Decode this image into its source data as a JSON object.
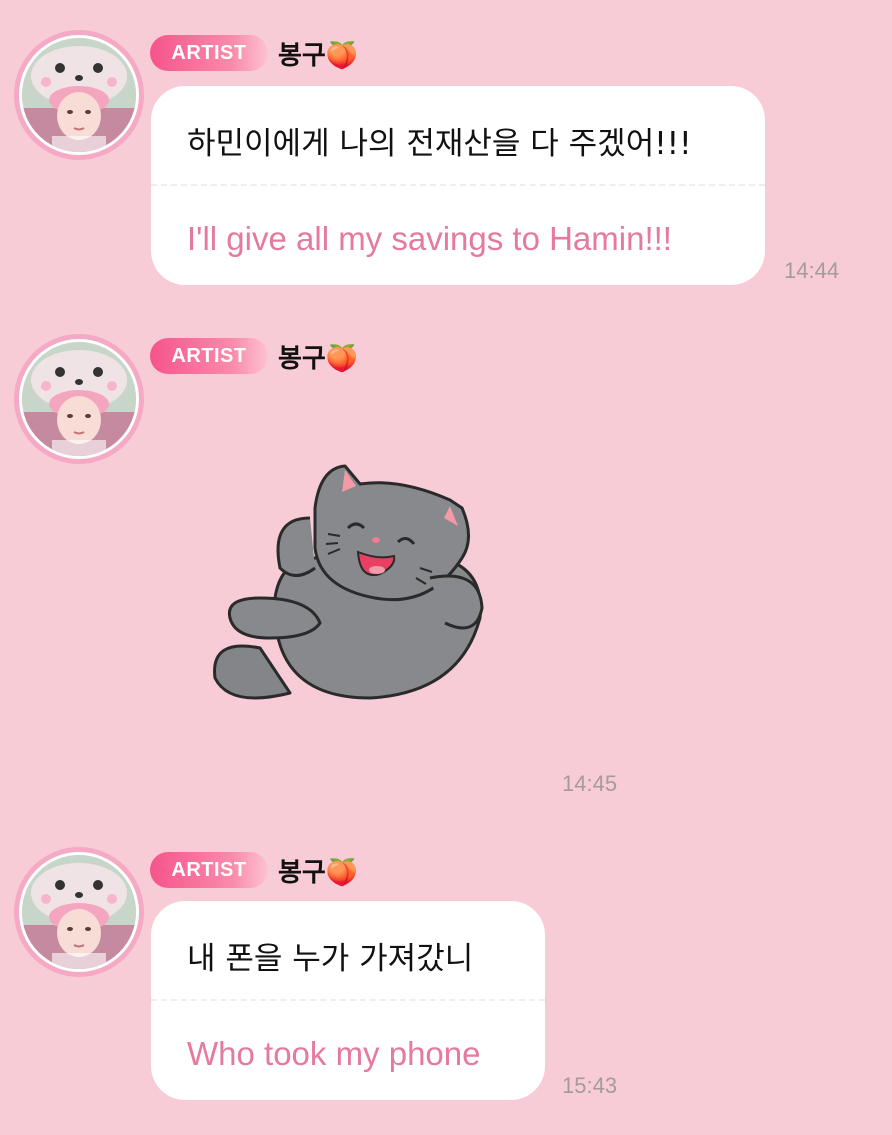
{
  "messages": [
    {
      "badge": "ARTIST",
      "sender": "봉구🍑",
      "korean": "하민이에게 나의 전재산을 다 주겠어!!!",
      "english": "I'll give all my savings to Hamin!!!",
      "time": "14:44"
    },
    {
      "badge": "ARTIST",
      "sender": "봉구🍑",
      "sticker": "gray-cat-lounging-sticker",
      "time": "14:45"
    },
    {
      "badge": "ARTIST",
      "sender": "봉구🍑",
      "korean": "내 폰을 누가 가져갔니",
      "english": "Who took my phone",
      "time": "15:43"
    }
  ],
  "colors": {
    "background": "#f8ccd6",
    "badge_start": "#f6548c",
    "translation_text": "#e5799e",
    "avatar_ring": "#f5a9c4",
    "timestamp": "#a39b9e"
  }
}
